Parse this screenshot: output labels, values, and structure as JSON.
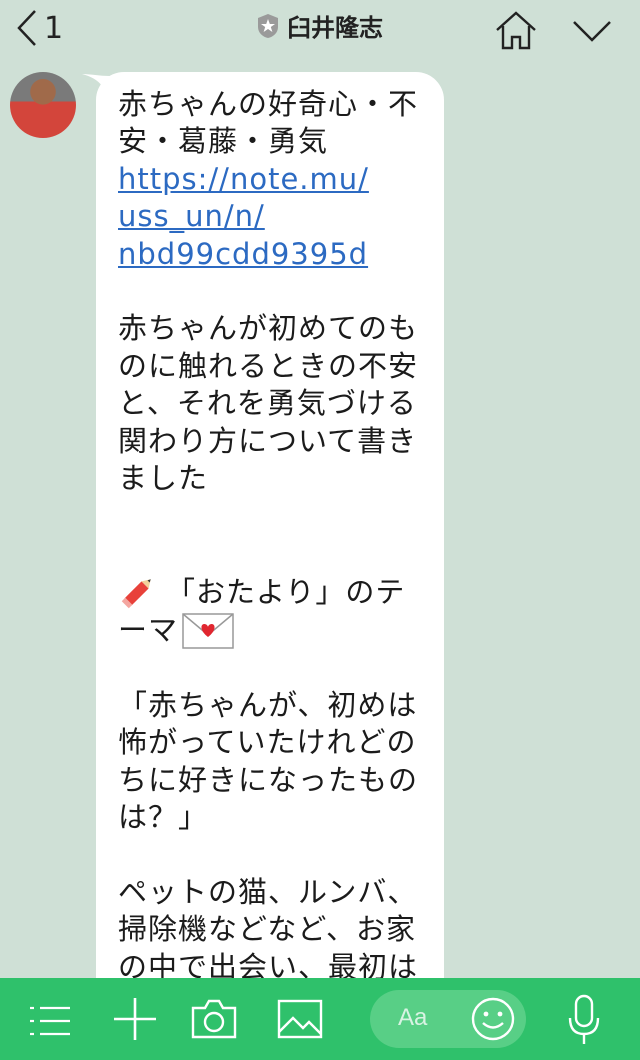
{
  "header": {
    "back_count": "1",
    "chat_title": "臼井隆志"
  },
  "message": {
    "lines_intro": [
      "赤ちゃんの好奇心・不",
      "安・葛藤・勇気"
    ],
    "link_lines": [
      "https://note.mu/",
      "uss_un/n/",
      "nbd99cdd9395d"
    ],
    "para1": [
      "赤ちゃんが初めてのも",
      "のに触れるときの不安",
      "と、それを勇気づける",
      "関わり方について書き",
      "ました"
    ],
    "theme_line1": "「おたより」のテ",
    "theme_line2": "ーマ",
    "question": [
      "「赤ちゃんが、初めは",
      "怖がっていたけれどの",
      "ちに好きになったもの",
      "は？」"
    ],
    "para2": [
      "ペットの猫、ルンバ、",
      "掃除機などなど、お家",
      "の中で出会い、最初は"
    ]
  },
  "input": {
    "placeholder": "Aa"
  },
  "colors": {
    "background": "#cfe0d6",
    "bottom_bar": "#2fc16b",
    "link": "#2c6ac2"
  }
}
